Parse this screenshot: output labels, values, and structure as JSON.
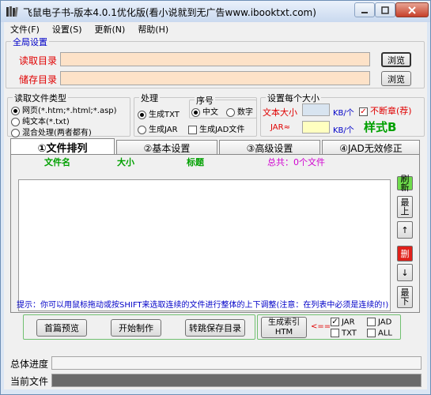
{
  "window": {
    "title": "飞鼠电子书-版本4.0.1优化版(看小说就到无广告www.ibooktxt.com)",
    "controls": [
      "minimize-icon",
      "maximize-icon",
      "close-icon"
    ]
  },
  "menu": [
    "文件(F)",
    "设置(S)",
    "更新(N)",
    "帮助(H)"
  ],
  "global": {
    "legend": "全局设置",
    "read_dir_label": "读取目录",
    "read_dir_value": "",
    "save_dir_label": "储存目录",
    "save_dir_value": "",
    "browse": "浏览"
  },
  "file_type": {
    "legend": "读取文件类型",
    "options": [
      "网页(*.htm;*.html;*.asp)",
      "纯文本(*.txt)",
      "混合处理(两者都有)"
    ],
    "selected": 0
  },
  "process": {
    "legend": "处理",
    "options": [
      "生成TXT",
      "生成JAR"
    ],
    "selected": 0
  },
  "sequence": {
    "legend": "序号",
    "options": [
      "中文",
      "数字"
    ],
    "selected": 0,
    "jad_label": "生成JAD文件",
    "jad_checked": false
  },
  "size": {
    "legend": "设置每个大小",
    "text_size_label": "文本大小",
    "text_size_value": "",
    "unit": "KB/个",
    "no_break_label": "不断章(荐)",
    "no_break_checked": true,
    "jar_label": "JAR≈",
    "jar_value": "",
    "style_label": "样式B"
  },
  "tabs": [
    "①文件排列",
    "②基本设置",
    "③高级设置",
    "④JAD无效修正"
  ],
  "active_tab": 0,
  "list": {
    "col_filename": "文件名",
    "col_size": "大小",
    "col_title": "标题",
    "total": "总共：0个文件"
  },
  "side_buttons": {
    "refresh": "刷新",
    "top": "最上",
    "up": "↑",
    "delete": "删",
    "down": "↓",
    "bottom": "最下"
  },
  "hint": "提示：你可以用鼠标拖动或按SHIFT来选取连续的文件进行整体的上下调整(注意：在列表中必须是连续的!)",
  "actions": {
    "preview": "首篇预览",
    "start": "开始制作",
    "goto_save": "转跳保存目录",
    "gen_index_line1": "生成索引",
    "gen_index_line2": "HTM",
    "arrow": "<=="
  },
  "formats": [
    {
      "label": "JAR",
      "checked": true
    },
    {
      "label": "JAD",
      "checked": false
    },
    {
      "label": "TXT",
      "checked": false
    },
    {
      "label": "ALL",
      "checked": false
    }
  ],
  "progress": {
    "total_label": "总体进度",
    "current_label": "当前文件",
    "total_value": 0,
    "current_value": 0
  },
  "colors": {
    "input_fill": "#fde2c8",
    "blue_label": "#0000c8",
    "red_label": "#e00000",
    "green_label": "#00a000",
    "refresh_bg": "#6fdc4c",
    "delete_bg": "#e0201a",
    "jar_input": "#ffffc0",
    "text_input": "#d8e4f0"
  }
}
